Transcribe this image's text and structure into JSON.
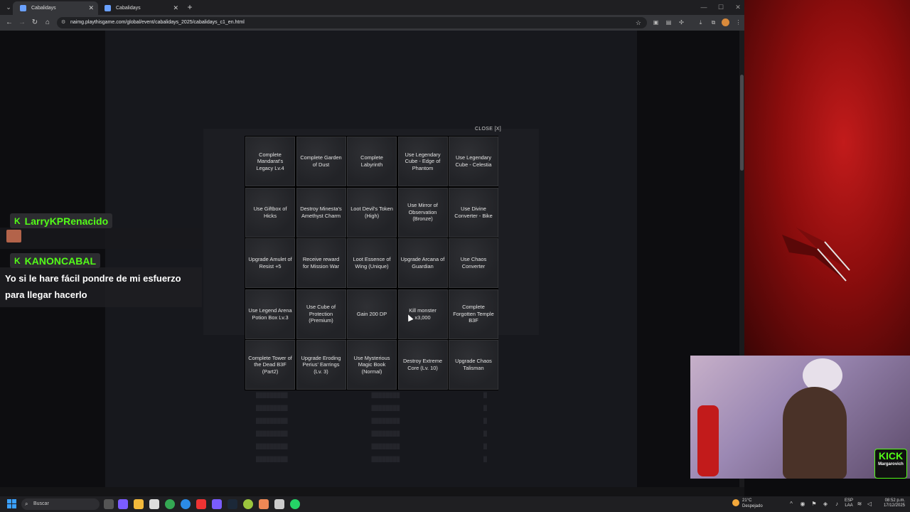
{
  "browser": {
    "tabs": [
      {
        "title": "Cabalidays",
        "active": true
      },
      {
        "title": "Cabalidays",
        "active": false
      }
    ],
    "url": "naimg.playthisgame.com/global/event/cabalidays_2025/cabalidays_c1_en.html"
  },
  "modal": {
    "close_label": "CLOSE [X]",
    "cells": [
      "Complete Mandarat's Legacy Lv.4",
      "Complete Garden of Dust",
      "Complete Labyrinth",
      "Use Legendary Cube - Edge of Phantom",
      "Use Legendary Cube - Celestia",
      "Use Giftbox of Hicks",
      "Destroy Minesta's Amethyst Charm",
      "Loot Devil's Token (High)",
      "Use Mirror of Observation (Bronze)",
      "Use Divine Converter - Bike",
      "Upgrade Amulet of Resist +5",
      "Receive reward for Mission War",
      "Loot Essence of Wing (Unique)",
      "Upgrade Arcana of Guardian",
      "Use Chaos Converter",
      "Use Legend Arena Potion Box Lv.3",
      "Use Cube of Protection (Premium)",
      "Gain 200 DP",
      "Kill monster x3,000",
      "Complete Forgotten Temple B3F",
      "Complete Tower of the Dead B3F (Part2)",
      "Upgrade Eroding Perius' Earrings (Lv. 3)",
      "Use Mysterious Magic Book (Normal)",
      "Destroy Extreme Core (Lv. 10)",
      "Upgrade Chaos Talisman"
    ]
  },
  "chat": {
    "messages": [
      {
        "user": "LarryKPRenacido",
        "text": ""
      },
      {
        "user": "KANONCABAL",
        "text": "Yo si le hare fácil pondre de mi esfuerzo para llegar hacerlo"
      }
    ]
  },
  "stream": {
    "kick_label": "KICK",
    "kick_channel": "Margarovich"
  },
  "taskbar": {
    "search_placeholder": "Buscar",
    "weather_temp": "21°C",
    "weather_desc": "Despejado",
    "lang": "ESP",
    "lang_region": "LAA",
    "time": "08:52 p.m.",
    "date": "17/12/2025"
  },
  "colors": {
    "kick_green": "#53fc18",
    "stream_red": "#c21b1b"
  }
}
